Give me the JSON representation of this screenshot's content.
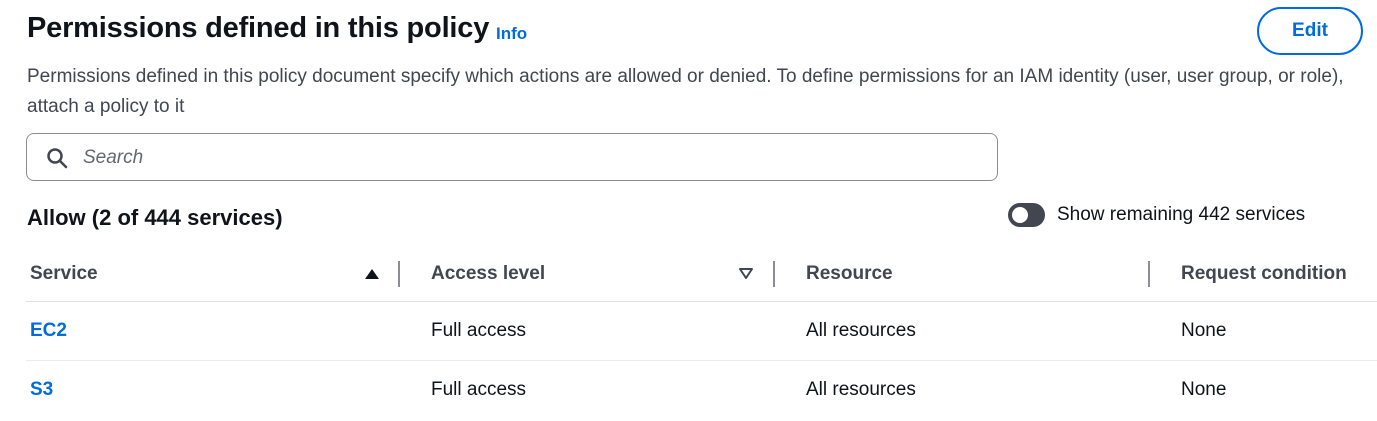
{
  "header": {
    "title": "Permissions defined in this policy",
    "info_label": "Info",
    "edit_label": "Edit"
  },
  "description": "Permissions defined in this policy document specify which actions are allowed or denied. To define permissions for an IAM identity (user, user group, or role), attach a policy to it",
  "search": {
    "placeholder": "Search",
    "value": ""
  },
  "allow_section": {
    "heading": "Allow (2 of 444 services)",
    "toggle_label": "Show remaining 442 services",
    "toggle_on": false
  },
  "table": {
    "columns": [
      "Service",
      "Access level",
      "Resource",
      "Request condition"
    ],
    "rows": [
      {
        "service": "EC2",
        "access_level": "Full access",
        "resource": "All resources",
        "request_condition": "None"
      },
      {
        "service": "S3",
        "access_level": "Full access",
        "resource": "All resources",
        "request_condition": "None"
      }
    ]
  },
  "icons": {
    "search": "search-icon",
    "sort_ascending": "sort-ascending-icon",
    "sort_descending": "sort-descending-icon"
  },
  "colors": {
    "link": "#006ce0",
    "heading": "#0f141a",
    "secondary_text": "#424650",
    "toggle_off": "#424650"
  }
}
